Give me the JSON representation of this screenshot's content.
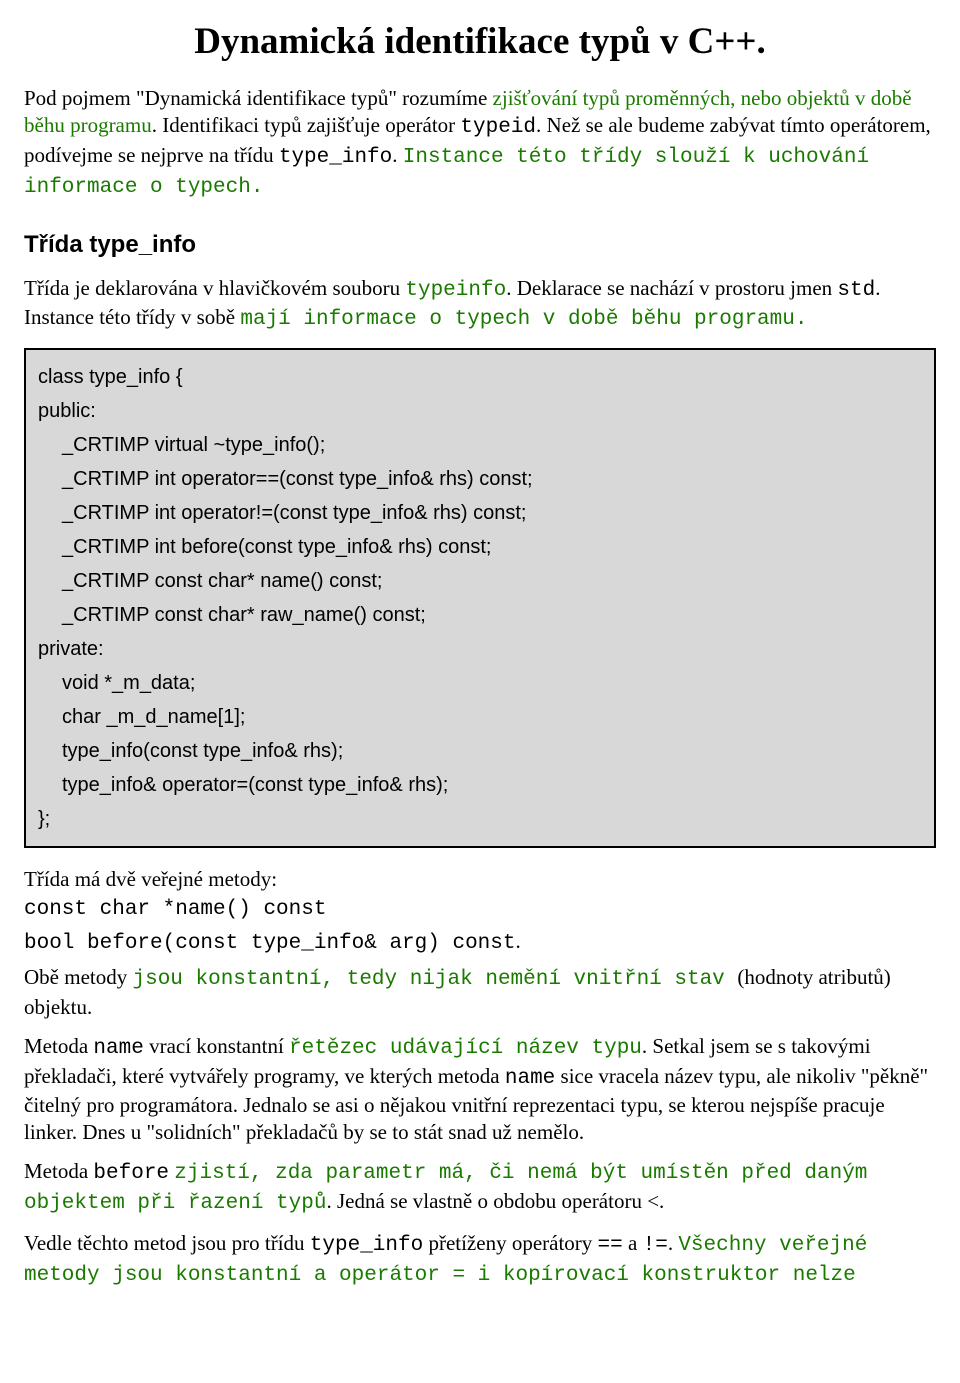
{
  "title": "Dynamická identifikace typů v C++.",
  "intro": {
    "p1a": "Pod pojmem \"Dynamická identifikace typů\" rozumíme ",
    "p1b": "zjišťování typů proměnných, nebo objektů v době běhu programu",
    "p1c": ". Identifikaci typů zajišťuje operátor ",
    "p1d": "typeid",
    "p1e": ". Než se ale budeme zabývat tímto operátorem, podívejme se nejprve na třídu ",
    "p1f": "type_info",
    "p1g": ". ",
    "p1h": "Instance této třídy slouží k uchování informace o typech."
  },
  "sec1_heading": "Třída type_info",
  "sec1": {
    "p1a": "Třída je deklarována v hlavičkovém souboru ",
    "p1b": "typeinfo",
    "p1c": ". Deklarace se nachází v prostoru jmen ",
    "p1d": "std",
    "p1e": ". Instance této třídy v sobě ",
    "p1f": "mají informace o typech v době běhu programu."
  },
  "code": {
    "l1": "class type_info {",
    "l2": "public:",
    "l3": "_CRTIMP virtual ~type_info();",
    "l4": "_CRTIMP int operator==(const type_info& rhs) const;",
    "l5": "_CRTIMP int operator!=(const type_info& rhs) const;",
    "l6": "_CRTIMP int before(const type_info& rhs) const;",
    "l7": "_CRTIMP const char* name() const;",
    "l8": "_CRTIMP const char* raw_name() const;",
    "l9": "private:",
    "l10": "void *_m_data;",
    "l11": "char _m_d_name[1];",
    "l12": "type_info(const type_info& rhs);",
    "l13": "type_info& operator=(const type_info& rhs);",
    "l14": "};"
  },
  "after": {
    "p1": "Třída má dvě veřejné metody:",
    "m1": "const char *name() const",
    "m2a": "bool before(const type_info& arg) const",
    "m2b": ".",
    "p2a": "Obě metody ",
    "p2b": "jsou konstantní, tedy nijak nemění vnitřní stav ",
    "p2c": "(hodnoty atributů) objektu.",
    "p3a": "Metoda ",
    "p3b": "name",
    "p3c": " vrací konstantní ",
    "p3d": "řetězec udávající název typu",
    "p3e": ". Setkal jsem se s takovými překladači, které vytvářely programy, ve kterých metoda ",
    "p3f": "name",
    "p3g": " sice vracela název typu, ale nikoliv \"pěkně\" čitelný pro programátora. Jednalo se asi o nějakou vnitřní reprezentaci typu, se kterou nejspíše pracuje linker. Dnes u \"solidních\" překladačů by se to stát snad už nemělo.",
    "p4a": "Metoda ",
    "p4b": "before",
    "p4c": " ",
    "p4d": "zjistí, zda parametr má, či nemá být umístěn před daným objektem při řazení typů",
    "p4e": ". Jedná se vlastně o obdobu operátoru <.",
    "p5a": "Vedle těchto metod jsou pro třídu ",
    "p5b": "type_info",
    "p5c": " přetíženy operátory ",
    "p5d": "==",
    "p5e": " a ",
    "p5f": "!=",
    "p5g": ". ",
    "p5h": "Všechny veřejné metody jsou konstantní a operátor = i kopírovací konstruktor nelze"
  }
}
